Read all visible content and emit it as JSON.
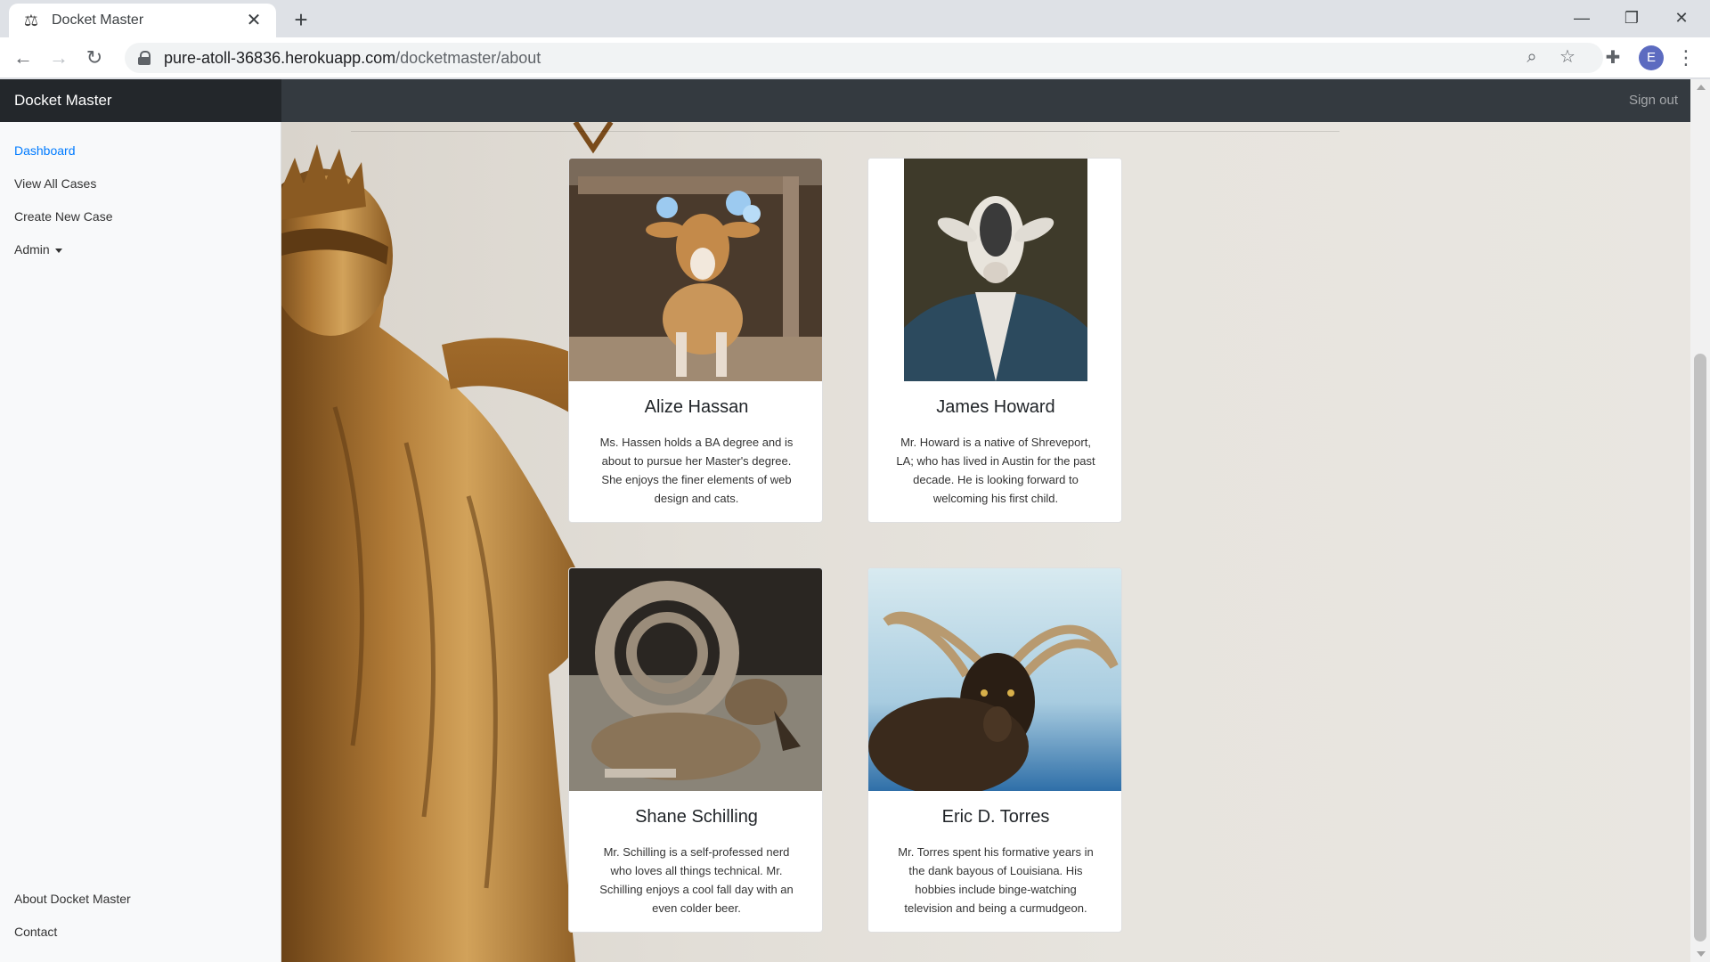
{
  "browser": {
    "tab_title": "Docket Master",
    "url_host": "pure-atoll-36836.herokuapp.com",
    "url_path": "/docketmaster/about",
    "profile_initial": "E"
  },
  "navbar": {
    "brand": "Docket Master",
    "signout": "Sign out"
  },
  "sidebar": {
    "items": [
      {
        "label": "Dashboard"
      },
      {
        "label": "View All Cases"
      },
      {
        "label": "Create New Case"
      },
      {
        "label": "Admin"
      }
    ],
    "footer": [
      {
        "label": "About Docket Master"
      },
      {
        "label": "Contact"
      }
    ]
  },
  "team": [
    {
      "name": "Alize Hassan",
      "bio": "Ms. Hassen holds a BA degree and is about to pursue her Master's degree. She enjoys the finer elements of web design and cats."
    },
    {
      "name": "James Howard",
      "bio": "Mr. Howard is a native of Shreveport, LA; who has lived in Austin for the past decade. He is looking forward to welcoming his first child."
    },
    {
      "name": "Shane Schilling",
      "bio": "Mr. Schilling is a self-professed nerd who loves all things technical. Mr. Schilling enjoys a cool fall day with an even colder beer."
    },
    {
      "name": "Eric D. Torres",
      "bio": "Mr. Torres spent his formative years in the dank bayous of Louisiana. His hobbies include binge-watching television and being a curmudgeon."
    }
  ]
}
